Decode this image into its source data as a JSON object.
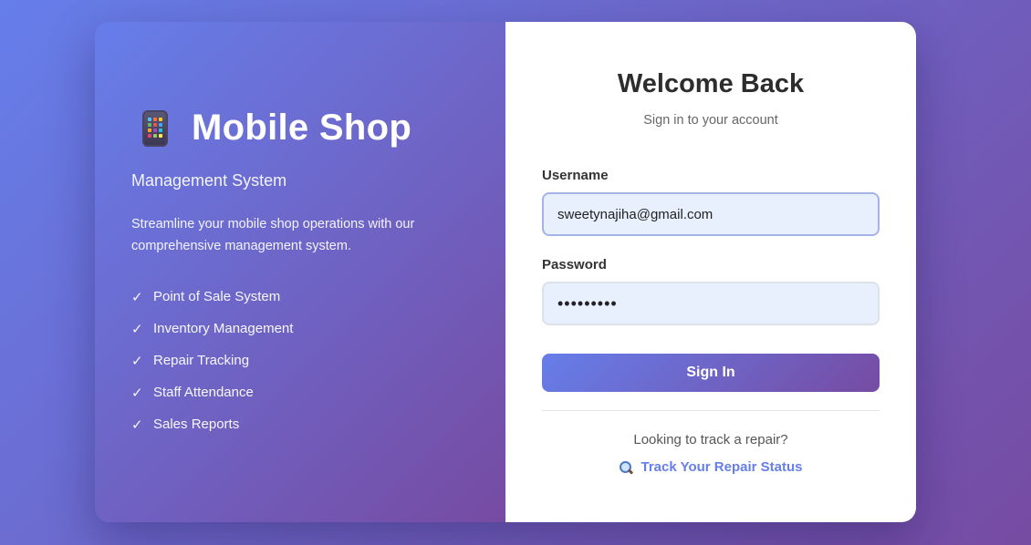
{
  "brand": {
    "icon": "mobile-phone-icon",
    "title": "Mobile Shop",
    "subtitle": "Management System",
    "description": "Streamline your mobile shop operations with our comprehensive management system."
  },
  "features": [
    {
      "check": "✓",
      "label": "Point of Sale System"
    },
    {
      "check": "✓",
      "label": "Inventory Management"
    },
    {
      "check": "✓",
      "label": "Repair Tracking"
    },
    {
      "check": "✓",
      "label": "Staff Attendance"
    },
    {
      "check": "✓",
      "label": "Sales Reports"
    }
  ],
  "login": {
    "title": "Welcome Back",
    "subtitle": "Sign in to your account",
    "username_label": "Username",
    "username_value": "sweetynajiha@gmail.com",
    "password_label": "Password",
    "password_value": "•••••••••",
    "submit_label": "Sign In"
  },
  "track": {
    "prompt": "Looking to track a repair?",
    "icon": "magnifier-icon",
    "link_label": "Track Your Repair Status"
  },
  "colors": {
    "gradient_start": "#667eea",
    "gradient_end": "#764ba2",
    "input_bg": "#e8f0fe",
    "link": "#667eea"
  }
}
